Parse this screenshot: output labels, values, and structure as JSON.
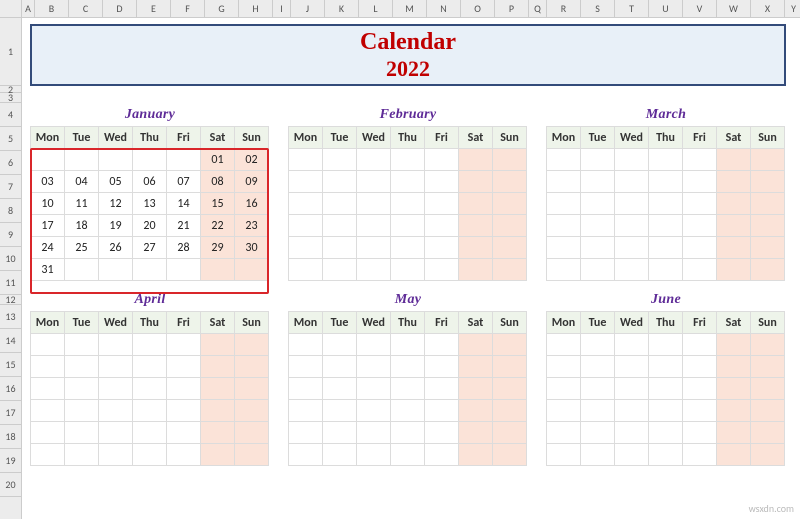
{
  "columns": [
    "A",
    "B",
    "C",
    "D",
    "E",
    "F",
    "G",
    "H",
    "I",
    "J",
    "K",
    "L",
    "M",
    "N",
    "O",
    "P",
    "Q",
    "R",
    "S",
    "T",
    "U",
    "V",
    "W",
    "X",
    "Y"
  ],
  "rows": [
    "1",
    "2",
    "3",
    "4",
    "5",
    "6",
    "7",
    "8",
    "9",
    "10",
    "11",
    "12",
    "13",
    "14",
    "15",
    "16",
    "17",
    "18",
    "19",
    "20"
  ],
  "banner": {
    "title": "Calendar",
    "year": "2022"
  },
  "dayHeaders": [
    "Mon",
    "Tue",
    "Wed",
    "Thu",
    "Fri",
    "Sat",
    "Sun"
  ],
  "months": [
    {
      "name": "January",
      "weeks": [
        [
          "",
          "",
          "",
          "",
          "",
          "01",
          "02"
        ],
        [
          "03",
          "04",
          "05",
          "06",
          "07",
          "08",
          "09"
        ],
        [
          "10",
          "11",
          "12",
          "13",
          "14",
          "15",
          "16"
        ],
        [
          "17",
          "18",
          "19",
          "20",
          "21",
          "22",
          "23"
        ],
        [
          "24",
          "25",
          "26",
          "27",
          "28",
          "29",
          "30"
        ],
        [
          "31",
          "",
          "",
          "",
          "",
          "",
          ""
        ]
      ]
    },
    {
      "name": "February",
      "weeks": [
        [
          "",
          "",
          "",
          "",
          "",
          "",
          ""
        ],
        [
          "",
          "",
          "",
          "",
          "",
          "",
          ""
        ],
        [
          "",
          "",
          "",
          "",
          "",
          "",
          ""
        ],
        [
          "",
          "",
          "",
          "",
          "",
          "",
          ""
        ],
        [
          "",
          "",
          "",
          "",
          "",
          "",
          ""
        ],
        [
          "",
          "",
          "",
          "",
          "",
          "",
          ""
        ]
      ]
    },
    {
      "name": "March",
      "weeks": [
        [
          "",
          "",
          "",
          "",
          "",
          "",
          ""
        ],
        [
          "",
          "",
          "",
          "",
          "",
          "",
          ""
        ],
        [
          "",
          "",
          "",
          "",
          "",
          "",
          ""
        ],
        [
          "",
          "",
          "",
          "",
          "",
          "",
          ""
        ],
        [
          "",
          "",
          "",
          "",
          "",
          "",
          ""
        ],
        [
          "",
          "",
          "",
          "",
          "",
          "",
          ""
        ]
      ]
    },
    {
      "name": "April",
      "weeks": [
        [
          "",
          "",
          "",
          "",
          "",
          "",
          ""
        ],
        [
          "",
          "",
          "",
          "",
          "",
          "",
          ""
        ],
        [
          "",
          "",
          "",
          "",
          "",
          "",
          ""
        ],
        [
          "",
          "",
          "",
          "",
          "",
          "",
          ""
        ],
        [
          "",
          "",
          "",
          "",
          "",
          "",
          ""
        ],
        [
          "",
          "",
          "",
          "",
          "",
          "",
          ""
        ]
      ]
    },
    {
      "name": "May",
      "weeks": [
        [
          "",
          "",
          "",
          "",
          "",
          "",
          ""
        ],
        [
          "",
          "",
          "",
          "",
          "",
          "",
          ""
        ],
        [
          "",
          "",
          "",
          "",
          "",
          "",
          ""
        ],
        [
          "",
          "",
          "",
          "",
          "",
          "",
          ""
        ],
        [
          "",
          "",
          "",
          "",
          "",
          "",
          ""
        ],
        [
          "",
          "",
          "",
          "",
          "",
          "",
          ""
        ]
      ]
    },
    {
      "name": "June",
      "weeks": [
        [
          "",
          "",
          "",
          "",
          "",
          "",
          ""
        ],
        [
          "",
          "",
          "",
          "",
          "",
          "",
          ""
        ],
        [
          "",
          "",
          "",
          "",
          "",
          "",
          ""
        ],
        [
          "",
          "",
          "",
          "",
          "",
          "",
          ""
        ],
        [
          "",
          "",
          "",
          "",
          "",
          "",
          ""
        ],
        [
          "",
          "",
          "",
          "",
          "",
          "",
          ""
        ]
      ]
    }
  ],
  "watermark": "wsxdn.com"
}
